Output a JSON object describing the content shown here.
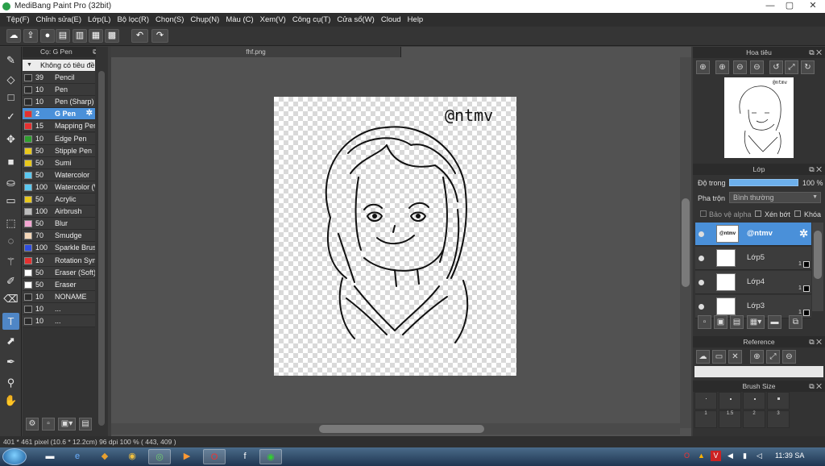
{
  "window": {
    "title": "MediBang Paint Pro (32bit)",
    "minimize": "—",
    "maximize": "▢",
    "close": "✕"
  },
  "menu": [
    "Tệp(F)",
    "Chỉnh sửa(E)",
    "Lớp(L)",
    "Bộ lọc(R)",
    "Chọn(S)",
    "Chụp(N)",
    "Màu (C)",
    "Xem(V)",
    "Công cụ(T)",
    "Cửa sổ(W)",
    "Cloud",
    "Help"
  ],
  "quick_toolbar": {
    "icons": [
      "cloud-icon",
      "share-icon",
      "comment-icon",
      "chat-icon",
      "page-icon",
      "pages-icon",
      "grid-icon",
      "undo-icon",
      "redo-icon"
    ]
  },
  "tools": [
    {
      "name": "brush-tool",
      "glyph": "✎"
    },
    {
      "name": "eraser-tool",
      "glyph": "◇"
    },
    {
      "name": "rectangle-tool",
      "glyph": "□"
    },
    {
      "name": "check-tool",
      "glyph": "✓"
    },
    {
      "name": "move-tool",
      "glyph": "✥"
    },
    {
      "name": "fill-rect-tool",
      "glyph": "■"
    },
    {
      "name": "bucket-tool",
      "glyph": "⛀"
    },
    {
      "name": "gradient-tool",
      "glyph": "▭"
    },
    {
      "name": "select-tool",
      "glyph": "⬚"
    },
    {
      "name": "lasso-tool",
      "glyph": "◌"
    },
    {
      "name": "magic-wand-tool",
      "glyph": "⚚"
    },
    {
      "name": "select-pen-tool",
      "glyph": "✐"
    },
    {
      "name": "select-eraser-tool",
      "glyph": "⌫"
    },
    {
      "name": "text-tool",
      "glyph": "T"
    },
    {
      "name": "operation-tool",
      "glyph": "⬈"
    },
    {
      "name": "blur-tool",
      "glyph": "✒"
    },
    {
      "name": "eyedropper-tool",
      "glyph": "⚲"
    },
    {
      "name": "hand-tool",
      "glyph": "✋"
    }
  ],
  "brush_panel": {
    "title": "Cọ: G Pen",
    "group": "Không có tiêu đề",
    "brushes": [
      {
        "size": "39",
        "name": "Pencil",
        "color": "#2a2a2a"
      },
      {
        "size": "10",
        "name": "Pen",
        "color": "#2a2a2a"
      },
      {
        "size": "10",
        "name": "Pen (Sharp)",
        "color": "#2a2a2a"
      },
      {
        "size": "2",
        "name": "G Pen",
        "color": "#e53030",
        "selected": true
      },
      {
        "size": "15",
        "name": "Mapping Pen",
        "color": "#e53030"
      },
      {
        "size": "10",
        "name": "Edge Pen",
        "color": "#2e9e2e"
      },
      {
        "size": "50",
        "name": "Stipple Pen",
        "color": "#e8c81c"
      },
      {
        "size": "50",
        "name": "Sumi",
        "color": "#e8c81c"
      },
      {
        "size": "50",
        "name": "Watercolor",
        "color": "#5bc8f0"
      },
      {
        "size": "100",
        "name": "Watercolor (W",
        "color": "#5bc8f0"
      },
      {
        "size": "50",
        "name": "Acrylic",
        "color": "#e8c81c"
      },
      {
        "size": "100",
        "name": "Airbrush",
        "color": "#bdbdbd"
      },
      {
        "size": "50",
        "name": "Blur",
        "color": "#f4a6d2"
      },
      {
        "size": "70",
        "name": "Smudge",
        "color": "#f5d7b8"
      },
      {
        "size": "100",
        "name": "Sparkle Brush",
        "color": "#2f4ee0"
      },
      {
        "size": "10",
        "name": "Rotation Sym",
        "color": "#e53030"
      },
      {
        "size": "50",
        "name": "Eraser (Soft)",
        "color": "#ffffff"
      },
      {
        "size": "50",
        "name": "Eraser",
        "color": "#ffffff"
      },
      {
        "size": "10",
        "name": "NONAME",
        "color": "#2a2a2a"
      },
      {
        "size": "10",
        "name": "...",
        "color": "#2a2a2a"
      },
      {
        "size": "10",
        "name": "...",
        "color": "#2a2a2a"
      }
    ]
  },
  "document": {
    "tab": "fhf.png",
    "watermark": "@ntmv"
  },
  "navigator": {
    "title": "Hoa tiêu"
  },
  "layer_panel": {
    "title": "Lớp",
    "opacity_label": "Độ trong",
    "opacity_value": "100 %",
    "opacity": 1.0,
    "blend_label": "Pha trộn",
    "blend_value": "Bình thường",
    "protect_alpha": "Bảo vệ alpha",
    "clipping": "Xén bớt",
    "lock": "Khóa",
    "layers": [
      {
        "name": "@ntmv",
        "thumb_text": "@ntmv",
        "selected": true
      },
      {
        "name": "Lớp5",
        "badge": "1"
      },
      {
        "name": "Lớp4",
        "badge": "1"
      },
      {
        "name": "Lớp3",
        "badge": "1"
      }
    ]
  },
  "reference_panel": {
    "title": "Reference"
  },
  "brush_size_panel": {
    "title": "Brush Size",
    "sizes": [
      "1",
      "1.5",
      "2",
      "3"
    ]
  },
  "status": {
    "text": "401 * 461 pixel   (10.6 * 12.2cm)   96 dpi   100 %   ( 443, 409 )"
  },
  "taskbar": {
    "clock": "11:39 SA"
  }
}
